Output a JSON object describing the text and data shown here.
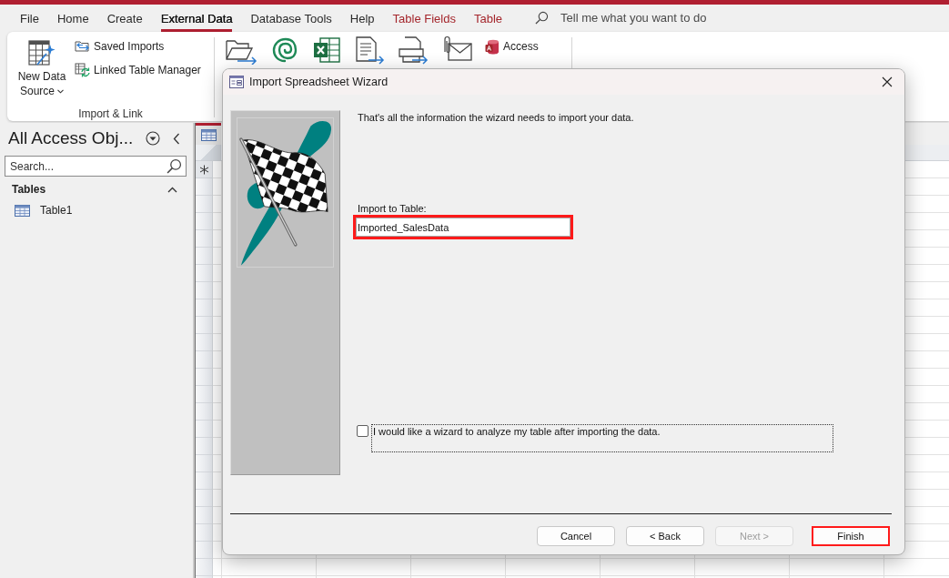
{
  "menu_tabs": [
    {
      "label": "File",
      "kind": "standard",
      "selected": false
    },
    {
      "label": "Home",
      "kind": "standard",
      "selected": false
    },
    {
      "label": "Create",
      "kind": "standard",
      "selected": false
    },
    {
      "label": "External Data",
      "kind": "standard",
      "selected": true
    },
    {
      "label": "Database Tools",
      "kind": "standard",
      "selected": false
    },
    {
      "label": "Help",
      "kind": "standard",
      "selected": false
    },
    {
      "label": "Table Fields",
      "kind": "contextual",
      "selected": false
    },
    {
      "label": "Table",
      "kind": "contextual",
      "selected": false
    }
  ],
  "tell_me": {
    "placeholder": "Tell me what you want to do"
  },
  "ribbon": {
    "import_group": {
      "title": "Import & Link",
      "new_data_source": "New Data Source",
      "commands": [
        {
          "label": "Saved Imports",
          "kind": "saved"
        },
        {
          "label": "Linked Table Manager",
          "kind": "linked"
        }
      ]
    },
    "export_group": {
      "access": "Access"
    }
  },
  "navigation_pane": {
    "title": "All Access Obj...",
    "search": {
      "placeholder": "Search..."
    },
    "groups": [
      {
        "label": "Tables",
        "expanded": true,
        "items": [
          {
            "label": "Table1",
            "selected": false
          }
        ]
      }
    ]
  },
  "dialog": {
    "title": "Import Spreadsheet Wizard",
    "message": "That's all the information the wizard needs to import your data.",
    "table_field": {
      "label": "Import to Table:",
      "value": "Imported_SalesData",
      "highlighted": true
    },
    "analyze_option": {
      "label": "I would like a wizard to analyze my table after importing the data.",
      "checked": false,
      "focused": true
    },
    "buttons": [
      {
        "label": "Cancel",
        "disabled": false,
        "highlighted": false
      },
      {
        "label": "< Back",
        "disabled": false,
        "highlighted": false
      },
      {
        "label": "Next >",
        "disabled": true,
        "highlighted": false
      },
      {
        "label": "Finish",
        "disabled": false,
        "highlighted": true
      }
    ]
  }
}
